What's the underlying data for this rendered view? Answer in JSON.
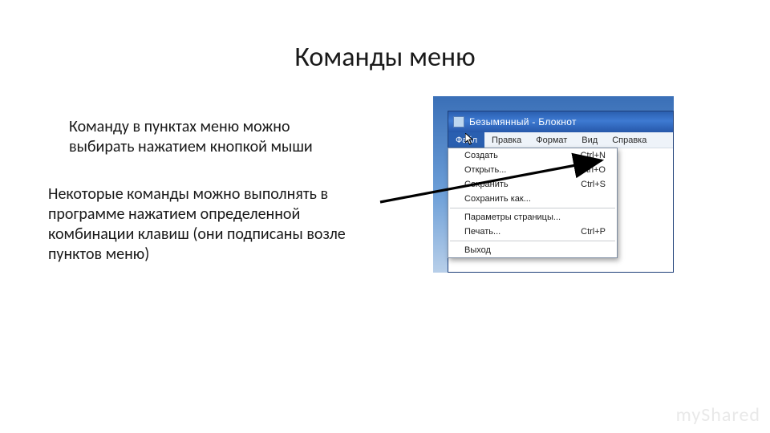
{
  "title": "Команды меню",
  "paragraph1": "Команду в пунктах меню можно выбирать нажатием кнопкой мыши",
  "paragraph2": "Некоторые команды можно выполнять в программе нажатием определенной комбинации клавиш (они подписаны возле пунктов меню)",
  "watermark": "myShared",
  "window": {
    "title": "Безымянный - Блокнот",
    "menubar": {
      "file": "Файл",
      "edit": "Правка",
      "format": "Формат",
      "view": "Вид",
      "help": "Справка"
    },
    "menu": {
      "items": [
        {
          "label": "Создать",
          "shortcut": "Ctrl+N"
        },
        {
          "label": "Открыть...",
          "shortcut": "Ctrl+O"
        },
        {
          "label": "Сохранить",
          "shortcut": "Ctrl+S"
        },
        {
          "label": "Сохранить как...",
          "shortcut": ""
        }
      ],
      "items2": [
        {
          "label": "Параметры страницы...",
          "shortcut": ""
        },
        {
          "label": "Печать...",
          "shortcut": "Ctrl+P"
        }
      ],
      "items3": [
        {
          "label": "Выход",
          "shortcut": ""
        }
      ]
    }
  }
}
